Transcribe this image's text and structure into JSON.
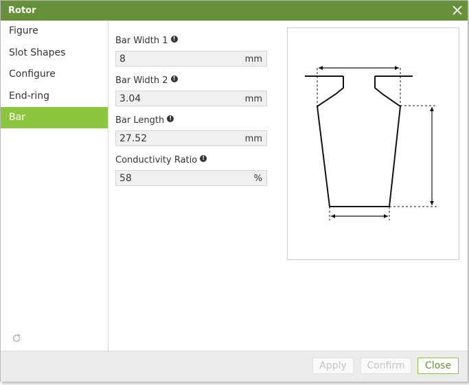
{
  "window": {
    "title": "Rotor"
  },
  "sidebar": {
    "items": [
      {
        "label": "Figure",
        "active": false
      },
      {
        "label": "Slot Shapes",
        "active": false
      },
      {
        "label": "Configure",
        "active": false
      },
      {
        "label": "End-ring",
        "active": false
      },
      {
        "label": "Bar",
        "active": true
      }
    ]
  },
  "fields": [
    {
      "label": "Bar Width 1",
      "value": "8",
      "unit": "mm"
    },
    {
      "label": "Bar Width 2",
      "value": "3.04",
      "unit": "mm"
    },
    {
      "label": "Bar Length",
      "value": "27.52",
      "unit": "mm"
    },
    {
      "label": "Conductivity Ratio",
      "value": "58",
      "unit": "%"
    }
  ],
  "footer": {
    "apply_label": "Apply",
    "confirm_label": "Confirm",
    "close_label": "Close"
  },
  "colors": {
    "titlebar": "#66913a",
    "active_nav": "#8cc63f"
  },
  "icons": {
    "close": "close-icon",
    "info": "info-icon",
    "refresh": "refresh-icon"
  }
}
